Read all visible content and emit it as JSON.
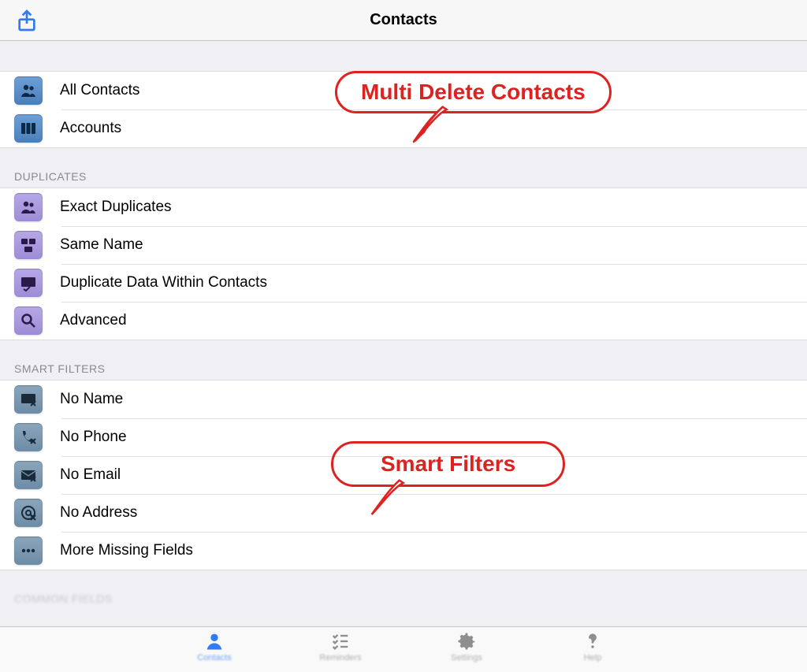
{
  "header": {
    "title": "Contacts"
  },
  "sections": {
    "main": {
      "items": [
        {
          "label": "All Contacts"
        },
        {
          "label": "Accounts"
        }
      ]
    },
    "duplicates": {
      "title": "DUPLICATES",
      "items": [
        {
          "label": "Exact Duplicates"
        },
        {
          "label": "Same Name"
        },
        {
          "label": "Duplicate Data Within Contacts"
        },
        {
          "label": "Advanced"
        }
      ]
    },
    "smart_filters": {
      "title": "SMART FILTERS",
      "items": [
        {
          "label": "No Name"
        },
        {
          "label": "No Phone"
        },
        {
          "label": "No Email"
        },
        {
          "label": "No Address"
        },
        {
          "label": "More Missing Fields"
        }
      ]
    },
    "next_header": "COMMON FIELDS"
  },
  "tabs": {
    "contacts": "Contacts",
    "reminders": "Reminders",
    "settings": "Settings",
    "help": "Help"
  },
  "annotations": {
    "multi_delete": "Multi Delete Contacts",
    "smart_filters": "Smart Filters"
  }
}
